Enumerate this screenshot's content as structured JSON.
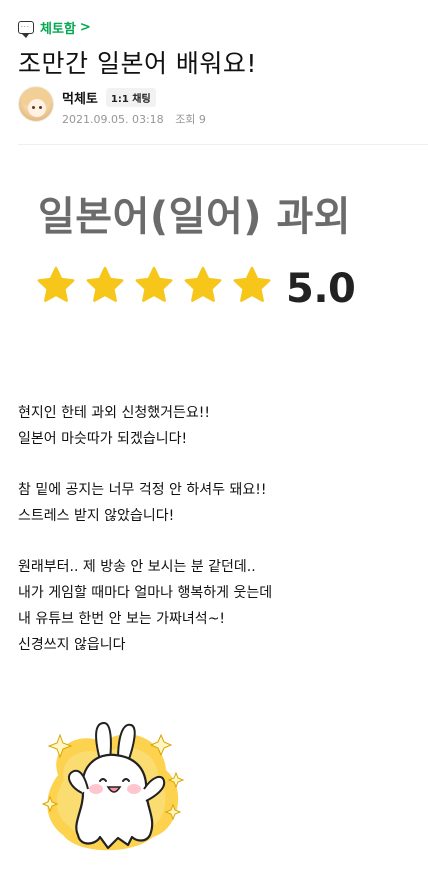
{
  "board": {
    "label": "체토함",
    "chevron": ">"
  },
  "post": {
    "title": "조만간 일본어 배워요!"
  },
  "author": {
    "name": "먹체토",
    "chat_badge": "1:1 채팅"
  },
  "meta": {
    "date": "2021.09.05. 03:18",
    "views": "조회 9"
  },
  "hero": {
    "title": "일본어(일어) 과외",
    "rating": "5.0",
    "stars": 5
  },
  "content": {
    "paragraphs": [
      [
        "현지인 한테 과외 신청했거든요!!",
        "일본어 마슷따가 되겠습니다!"
      ],
      [
        "참 밑에 공지는 너무 걱정 안 하셔두 돼요!!",
        "스트레스 받지 않았습니다!"
      ],
      [
        "원래부터.. 제 방송 안 보시는 분 같던데..",
        "내가 게임할 때마다 얼마나 행복하게 웃는데",
        "내 유튜브 한번 안 보는 가짜녀석~!",
        "신경쓰지 않읍니다"
      ]
    ]
  },
  "colors": {
    "accent_green": "#03a94f",
    "star_yellow": "#f6c61a",
    "meta_gray": "#979797"
  },
  "icons": {
    "board": "chat-bubble-icon",
    "star": "star-icon",
    "sticker": "bunny-sticker"
  }
}
